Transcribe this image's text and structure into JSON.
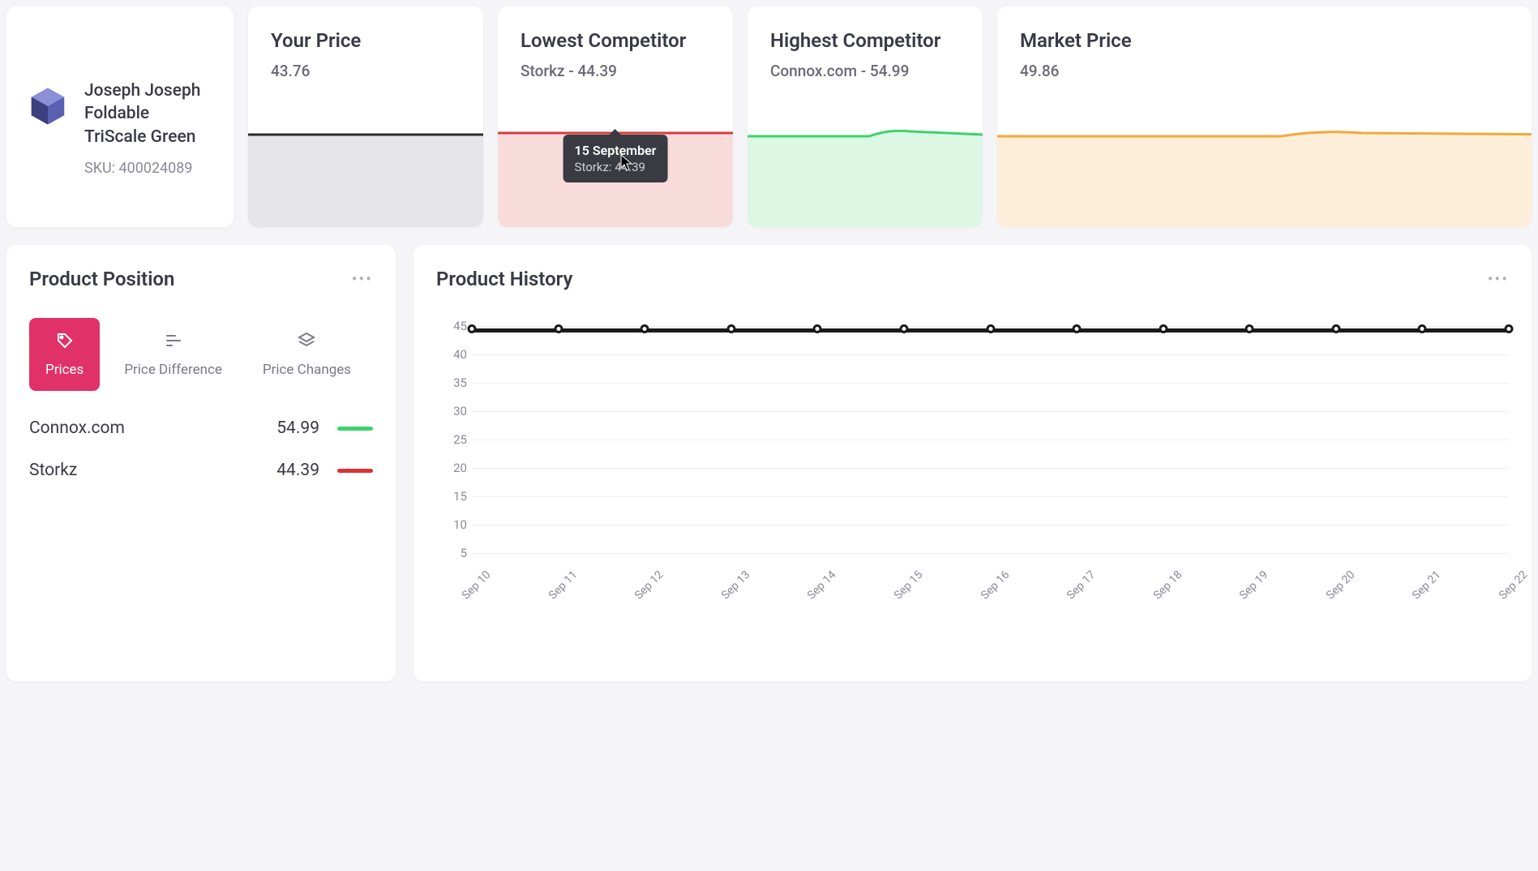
{
  "product": {
    "name": "Joseph Joseph Foldable TriScale Green",
    "sku_label": "SKU: 400024089"
  },
  "cards": {
    "your_price": {
      "title": "Your Price",
      "value": "43.76"
    },
    "lowest": {
      "title": "Lowest Competitor",
      "value": "Storkz - 44.39"
    },
    "highest": {
      "title": "Highest Competitor",
      "value": "Connox.com - 54.99"
    },
    "market": {
      "title": "Market Price",
      "value": "49.86"
    }
  },
  "tooltip": {
    "date": "15 September",
    "detail": "Storkz: 44.39"
  },
  "position": {
    "title": "Product Position",
    "tabs": {
      "prices": "Prices",
      "diff": "Price Difference",
      "changes": "Price Changes"
    },
    "rows": [
      {
        "name": "Connox.com",
        "price": "54.99",
        "color": "#3bd36b"
      },
      {
        "name": "Storkz",
        "price": "44.39",
        "color": "#e03030"
      }
    ]
  },
  "history": {
    "title": "Product History"
  },
  "colors": {
    "your": "#4a4a52",
    "lowest": "#d93b3b",
    "highest": "#3bd36b",
    "market": "#f2a93b"
  },
  "chart_data": {
    "type": "line",
    "title": "Product History",
    "xlabel": "",
    "ylabel": "",
    "ylim": [
      5,
      45
    ],
    "y_ticks": [
      45,
      40,
      35,
      30,
      25,
      20,
      15,
      10,
      5
    ],
    "categories": [
      "Sep 10",
      "Sep 11",
      "Sep 12",
      "Sep 13",
      "Sep 14",
      "Sep 15",
      "Sep 16",
      "Sep 17",
      "Sep 18",
      "Sep 19",
      "Sep 20",
      "Sep 21",
      "Sep 22"
    ],
    "series": [
      {
        "name": "Storkz",
        "values": [
          44.39,
          44.39,
          44.39,
          44.39,
          44.39,
          44.39,
          44.39,
          44.39,
          44.39,
          44.39,
          44.39,
          44.39,
          44.39
        ]
      }
    ]
  }
}
